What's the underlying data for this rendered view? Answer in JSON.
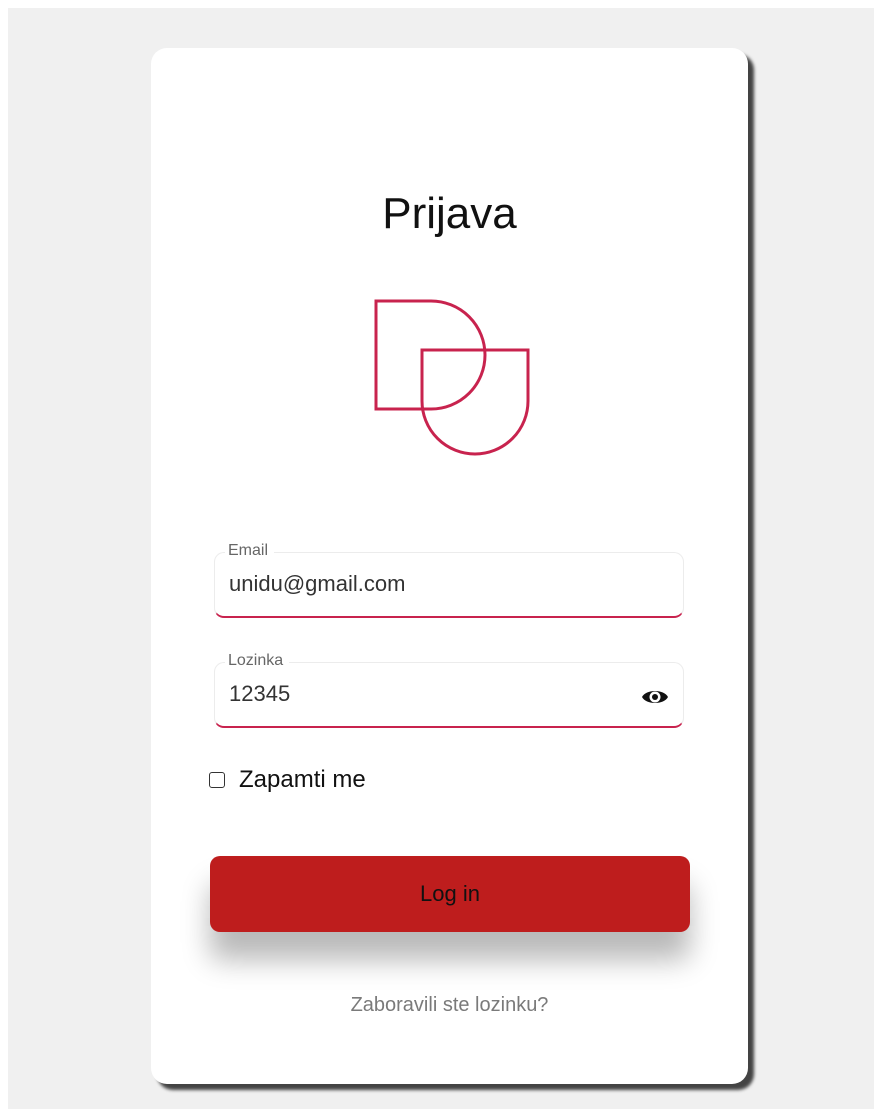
{
  "login": {
    "title": "Prijava",
    "email": {
      "label": "Email",
      "value": "unidu@gmail.com"
    },
    "password": {
      "label": "Lozinka",
      "value": "12345"
    },
    "remember_label": "Zapamti me",
    "remember_checked": false,
    "submit_label": "Log in",
    "forgot_label": "Zaboravili ste lozinku?"
  },
  "colors": {
    "accent": "#c8234e",
    "button": "#be1d1d",
    "background": "#f0f0f0"
  },
  "icons": {
    "logo": "du-logo",
    "password_toggle": "eye-icon"
  }
}
